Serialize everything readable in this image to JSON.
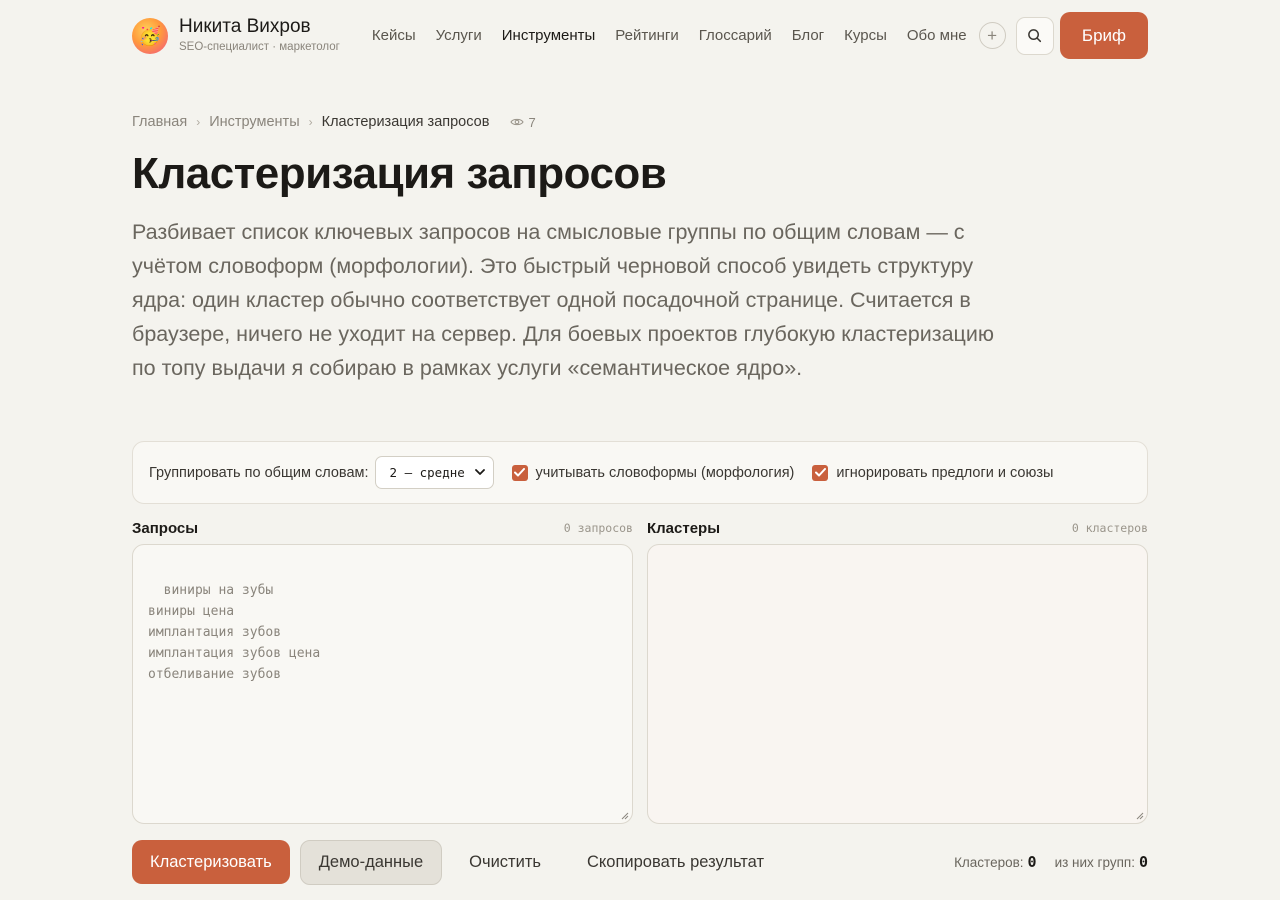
{
  "header": {
    "avatar_emoji": "🥳",
    "name": "Никита Вихров",
    "subtitle": "SEO-специалист · маркетолог",
    "nav": [
      {
        "label": "Кейсы",
        "active": false
      },
      {
        "label": "Услуги",
        "active": false
      },
      {
        "label": "Инструменты",
        "active": true
      },
      {
        "label": "Рейтинги",
        "active": false
      },
      {
        "label": "Глоссарий",
        "active": false
      },
      {
        "label": "Блог",
        "active": false
      },
      {
        "label": "Курсы",
        "active": false
      },
      {
        "label": "Обо мне",
        "active": false
      }
    ],
    "plus_icon": "+",
    "brief_label": "Бриф",
    "accent_color": "#c9603d"
  },
  "breadcrumb": {
    "home": "Главная",
    "section": "Инструменты",
    "current": "Кластеризация запросов",
    "separator": "›",
    "views": "7"
  },
  "page": {
    "title": "Кластеризация запросов",
    "lead": "Разбивает список ключевых запросов на смысловые группы по общим словам — с учётом словоформ (морфологии). Это быстрый черновой способ увидеть структуру ядра: один кластер обычно соответствует одной посадочной странице. Считается в браузере, ничего не уходит на сервер. Для боевых проектов глубокую кластеризацию по топу выдачи я собираю в рамках услуги «семантическое ядро»."
  },
  "options": {
    "group_label": "Группировать по общим словам:",
    "group_value": "2 — средне",
    "morphology_label": "учитывать словоформы (морфология)",
    "morphology_checked": true,
    "ignore_label": "игнорировать предлоги и союзы",
    "ignore_checked": true
  },
  "input_panel": {
    "title": "Запросы",
    "count": "0 запросов",
    "placeholder": "виниры на зубы\nвиниры цена\nимплантация зубов\nимплантация зубов цена\nотбеливание зубов"
  },
  "output_panel": {
    "title": "Кластеры",
    "count": "0 кластеров",
    "value": ""
  },
  "actions": {
    "cluster_label": "Кластеризовать",
    "demo_label": "Демо-данные",
    "clear_label": "Очистить",
    "copy_label": "Скопировать результат"
  },
  "stats": {
    "clusters_label": "Кластеров:",
    "clusters_value": "0",
    "groups_label": "из них групп:",
    "groups_value": "0"
  }
}
